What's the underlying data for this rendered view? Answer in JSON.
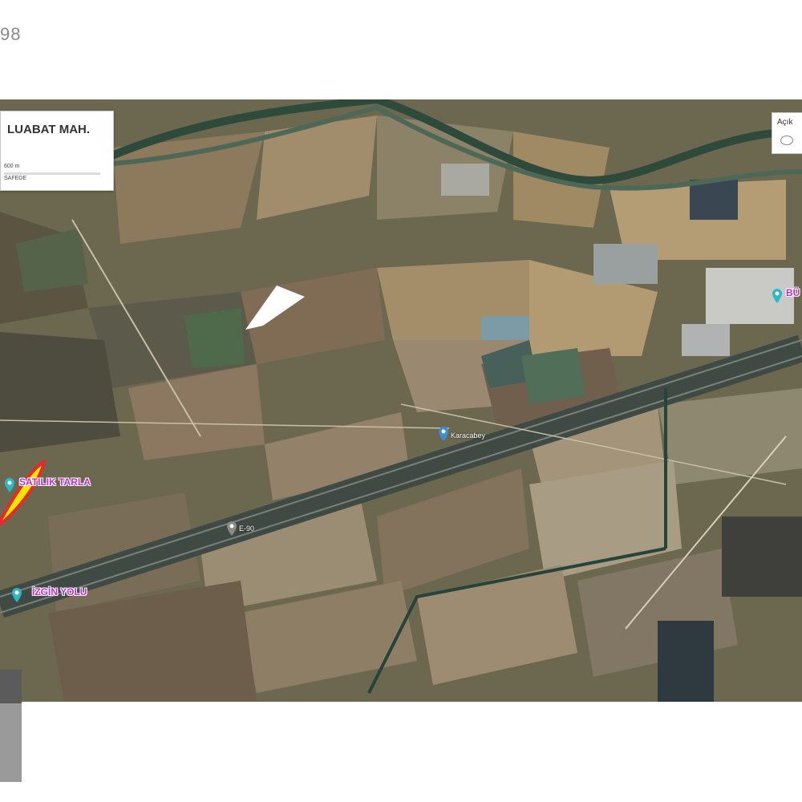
{
  "page": {
    "corner_number": "98"
  },
  "map": {
    "info_box": {
      "title": "LUABAT MAH.",
      "scale": "600 m",
      "subtitle": "SAFEDE"
    },
    "side_panel": {
      "label": "Açık"
    },
    "places": [
      {
        "label": "SATILIK TARLA",
        "color": "#c02bd2"
      },
      {
        "label": "İZGİN YOLU",
        "color": "#c02bd2"
      },
      {
        "label": "BÜ",
        "color": "#c02bd2"
      }
    ],
    "roads": {
      "highway_label": "E-90",
      "secondary_label": "Karacabey"
    },
    "colors": {
      "highlight_fill": "#f2e600",
      "highlight_outline": "#e32b2b",
      "pin": "#2fb7c9"
    }
  }
}
